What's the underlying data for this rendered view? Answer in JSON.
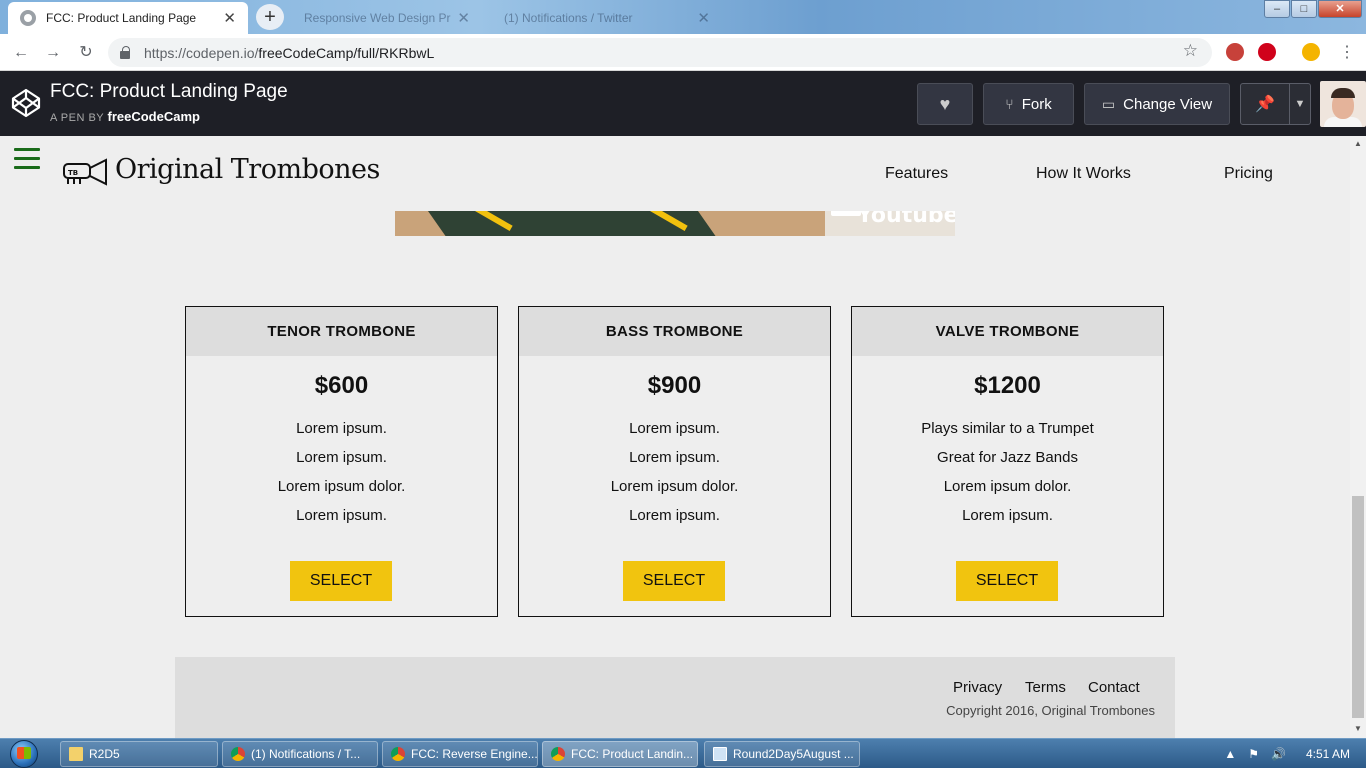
{
  "browser": {
    "tabs": [
      {
        "title": "FCC: Product Landing Page",
        "active": true
      },
      {
        "title": "Responsive Web Design Project",
        "active": false
      },
      {
        "title": "(1) Notifications / Twitter",
        "active": false
      }
    ],
    "new_tab_label": "+",
    "url_host": "https://codepen.io/",
    "url_path": "freeCodeCamp/full/RKRbwL",
    "window_controls": {
      "minimize": "–",
      "maximize": "□",
      "close": "✕"
    }
  },
  "codepen": {
    "title": "FCC: Product Landing Page",
    "by_prefix": "A PEN BY",
    "author": "freeCodeCamp",
    "fork_label": "Fork",
    "change_view_label": "Change View"
  },
  "site": {
    "brand": "Original Trombones",
    "nav": [
      "Features",
      "How It Works",
      "Pricing"
    ],
    "video_text": "Youtube",
    "pricing": [
      {
        "name": "TENOR TROMBONE",
        "price": "$600",
        "features": [
          "Lorem ipsum.",
          "Lorem ipsum.",
          "Lorem ipsum dolor.",
          "Lorem ipsum."
        ],
        "button": "SELECT"
      },
      {
        "name": "BASS TROMBONE",
        "price": "$900",
        "features": [
          "Lorem ipsum.",
          "Lorem ipsum.",
          "Lorem ipsum dolor.",
          "Lorem ipsum."
        ],
        "button": "SELECT"
      },
      {
        "name": "VALVE TROMBONE",
        "price": "$1200",
        "features": [
          "Plays similar to a Trumpet",
          "Great for Jazz Bands",
          "Lorem ipsum dolor.",
          "Lorem ipsum."
        ],
        "button": "SELECT"
      }
    ],
    "footer": {
      "links": [
        "Privacy",
        "Terms",
        "Contact"
      ],
      "copyright": "Copyright 2016, Original Trombones"
    }
  },
  "taskbar": {
    "items": [
      {
        "label": "R2D5",
        "icon": "folder"
      },
      {
        "label": "(1) Notifications / T...",
        "icon": "chrome"
      },
      {
        "label": "FCC: Reverse Engine...",
        "icon": "chrome"
      },
      {
        "label": "FCC: Product Landin...",
        "icon": "chrome",
        "active": true
      },
      {
        "label": "Round2Day5August ...",
        "icon": "notepad"
      }
    ],
    "clock": "4:51 AM"
  },
  "colors": {
    "accent": "#f1c40f",
    "hamburger": "#1a6b1a",
    "codepen_bar": "#1e1f26"
  }
}
